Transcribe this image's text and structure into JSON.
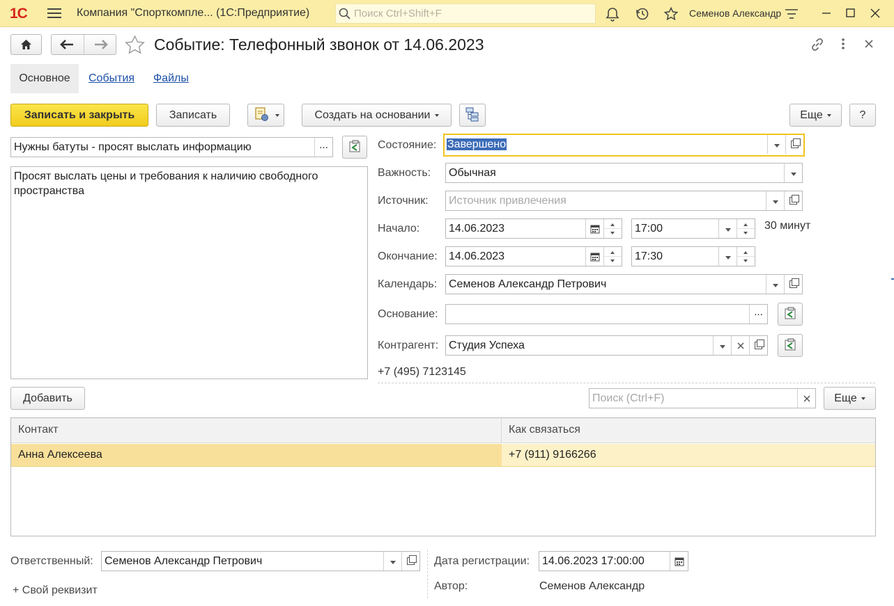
{
  "app": {
    "logo": "1С",
    "title": "Компания \"Спорткомпле...   (1С:Предприятие)",
    "search_placeholder": "Поиск Ctrl+Shift+F",
    "user": "Семенов Александр"
  },
  "form": {
    "title": "Событие: Телефонный звонок от 14.06.2023",
    "tabs": [
      {
        "label": "Основное"
      },
      {
        "label": "События"
      },
      {
        "label": "Файлы"
      }
    ]
  },
  "toolbar": {
    "save_close": "Записать и закрыть",
    "save": "Записать",
    "create_based": "Создать на основании",
    "more": "Еще",
    "help": "?"
  },
  "subject": "Нужны батуты - просят выслать информацию",
  "subject_btn": "...",
  "description": "Просят выслать цены и требования к наличию свободного пространства",
  "fields": {
    "state": {
      "label": "Состояние:",
      "value": "Завершено"
    },
    "importance": {
      "label": "Важность:",
      "value": "Обычная"
    },
    "source": {
      "label": "Источник:",
      "placeholder": "Источник привлечения"
    },
    "start": {
      "label": "Начало:",
      "date": "14.06.2023",
      "time": "17:00"
    },
    "duration": "30 минут",
    "end": {
      "label": "Окончание:",
      "date": "14.06.2023",
      "time": "17:30"
    },
    "calendar": {
      "label": "Календарь:",
      "value": "Семенов Александр Петрович"
    },
    "basis": {
      "label": "Основание:",
      "value": "",
      "btn": "..."
    },
    "counterparty": {
      "label": "Контрагент:",
      "value": "Студия Успеха"
    },
    "phone": "+7 (495) 7123145"
  },
  "contacts": {
    "add_button": "Добавить",
    "search_placeholder": "Поиск (Ctrl+F)",
    "more": "Еще",
    "columns": [
      "Контакт",
      "Как связаться"
    ],
    "rows": [
      {
        "contact": "Анна Алексеева",
        "how": "+7 (911) 9166266"
      }
    ]
  },
  "footer": {
    "responsible_label": "Ответственный:",
    "responsible_value": "Семенов Александр Петрович",
    "custom_attr": "+ Свой реквизит",
    "reg_date_label": "Дата регистрации:",
    "reg_date_value": "14.06.2023 17:00:00",
    "author_label": "Автор:",
    "author_value": "Семенов Александр"
  },
  "colors": {
    "titlebar": "#fbeda6",
    "primary_button": "#f5d42a",
    "selection": "#fbe8a4",
    "link": "#1b4fa8",
    "logo": "#d7261e"
  }
}
